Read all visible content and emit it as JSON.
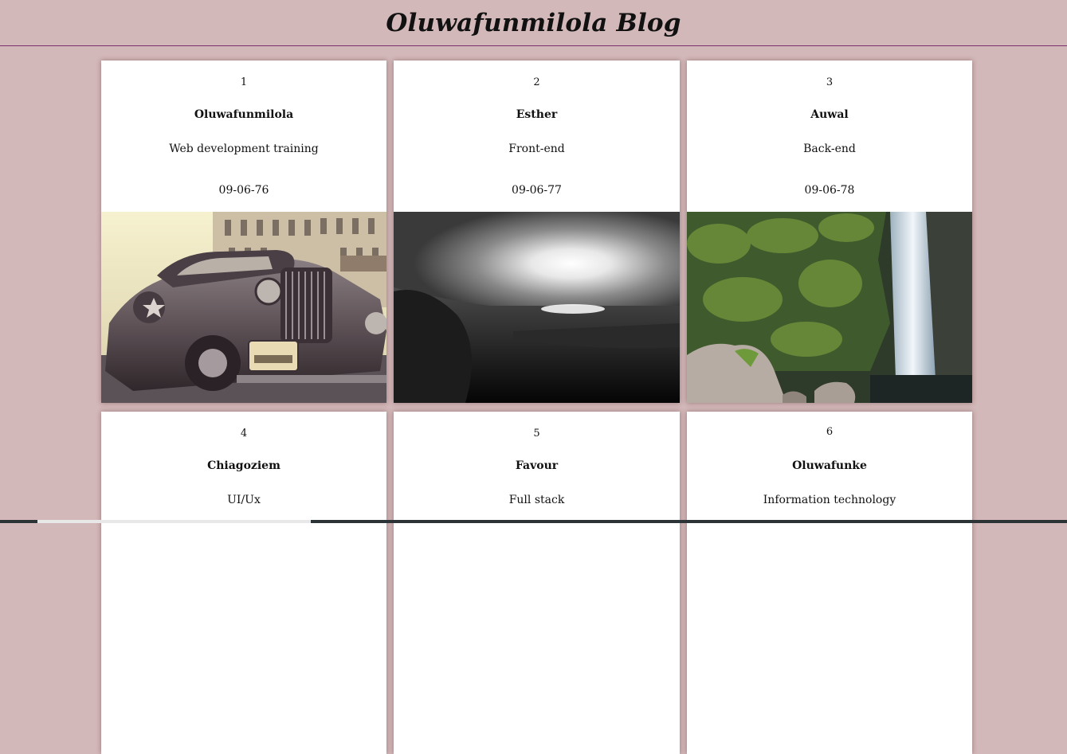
{
  "page": {
    "title": "Oluwafunmilola Blog"
  },
  "cards": [
    {
      "number": "1",
      "name": "Oluwafunmilola",
      "role": "Web development training",
      "date": "09-06-76",
      "image": "vintage-car-photo"
    },
    {
      "number": "2",
      "name": "Esther",
      "role": "Front-end",
      "date": "09-06-77",
      "image": "sunset-field-photo"
    },
    {
      "number": "3",
      "name": "Auwal",
      "role": "Back-end",
      "date": "09-06-78",
      "image": "waterfall-photo"
    },
    {
      "number": "4",
      "name": "Chiagoziem",
      "role": "UI/Ux",
      "date": "",
      "image": ""
    },
    {
      "number": "5",
      "name": "Favour",
      "role": "Full stack",
      "date": "",
      "image": ""
    },
    {
      "number": "6",
      "name": "Oluwafunke",
      "role": "Information technology",
      "date": "",
      "image": ""
    }
  ],
  "colors": {
    "background": "#d3b8b9",
    "card": "#ffffff",
    "header_rule": "#7a2d6f"
  }
}
